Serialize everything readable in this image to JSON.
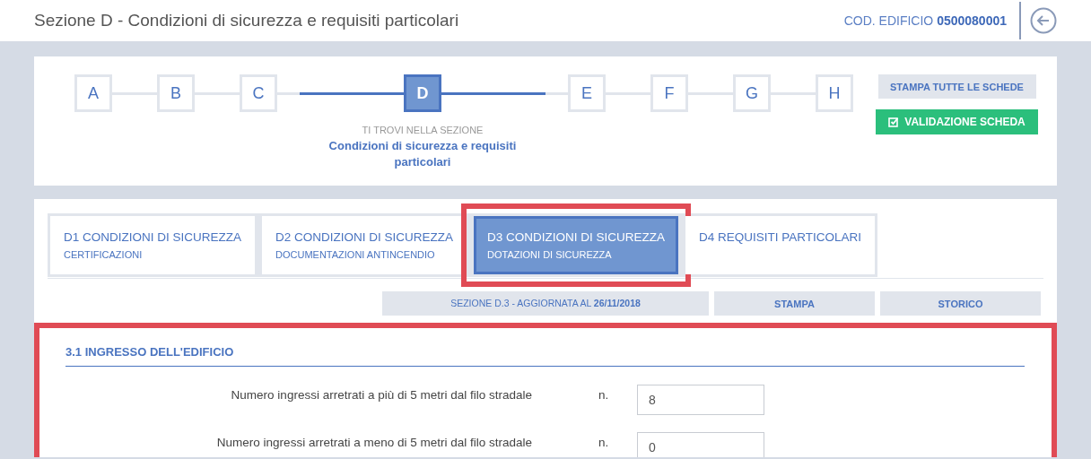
{
  "header": {
    "title": "Sezione D - Condizioni di sicurezza e requisiti particolari",
    "code_label": "COD. EDIFICIO",
    "code": "0500080001"
  },
  "stepper": {
    "steps": [
      {
        "label": "A",
        "selected": false
      },
      {
        "label": "B",
        "selected": false
      },
      {
        "label": "C",
        "selected": false
      },
      {
        "label": "D",
        "selected": true
      },
      {
        "label": "E",
        "selected": false
      },
      {
        "label": "F",
        "selected": false
      },
      {
        "label": "G",
        "selected": false
      },
      {
        "label": "H",
        "selected": false
      }
    ],
    "current_caption": "TI TROVI NELLA SEZIONE",
    "current_title": "Condizioni di sicurezza e requisiti particolari",
    "buttons": [
      {
        "label": "STAMPA TUTTE LE SCHEDE",
        "kind": "secondary"
      },
      {
        "label": "VALIDAZIONE SCHEDA",
        "kind": "primary"
      }
    ]
  },
  "tabs": [
    {
      "title": "D1 CONDIZIONI DI SICUREZZA",
      "subtitle": "CERTIFICAZIONI",
      "selected": false,
      "highlighted": false
    },
    {
      "title": "D2 CONDIZIONI DI SICUREZZA",
      "subtitle": "DOCUMENTAZIONI ANTINCENDIO",
      "selected": false,
      "highlighted": false
    },
    {
      "title": "D3 CONDIZIONI DI SICUREZZA",
      "subtitle": "DOTAZIONI DI SICUREZZA",
      "selected": true,
      "highlighted": true
    },
    {
      "title": "D4 REQUISITI PARTICOLARI",
      "selected": false,
      "highlighted": false
    }
  ],
  "toolbar": {
    "status": "SEZIONE D.3 - AGGIORNATA AL **26/11/2018**",
    "buttons": [
      "STAMPA",
      "STORICO"
    ]
  },
  "section": {
    "title": "3.1 INGRESSO DELL'EDIFICIO",
    "highlighted": true,
    "fields": [
      {
        "label": "Numero ingressi arretrati a più di 5 metri dal filo stradale",
        "unit": "n.",
        "value": "8"
      },
      {
        "label": "Numero ingressi arretrati a meno di 5 metri dal filo stradale",
        "unit": "n.",
        "value": "0"
      }
    ]
  }
}
